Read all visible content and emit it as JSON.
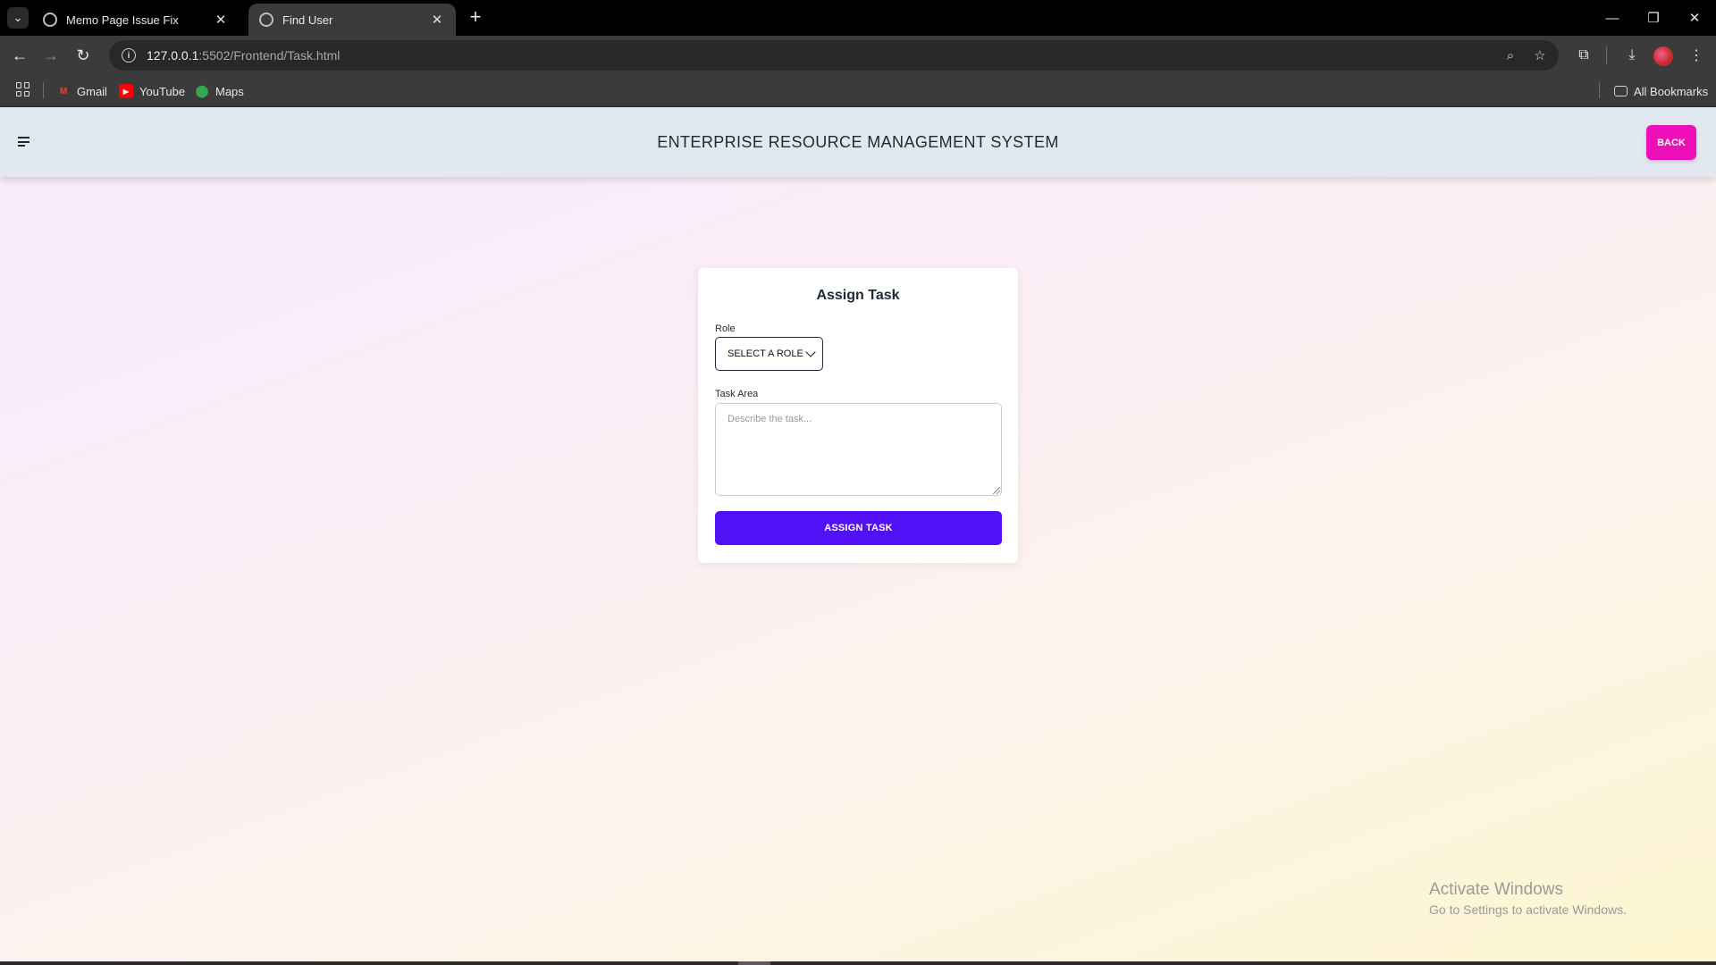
{
  "browser": {
    "tabs": [
      {
        "title": "Memo Page Issue Fix",
        "active": false
      },
      {
        "title": "Find User",
        "active": true
      }
    ],
    "url": {
      "host": "127.0.0.1",
      "path": ":5502/Frontend/Task.html"
    },
    "bookmarks": [
      {
        "label": "Gmail",
        "icon": "gmail-icon"
      },
      {
        "label": "YouTube",
        "icon": "youtube-icon"
      },
      {
        "label": "Maps",
        "icon": "maps-icon"
      }
    ],
    "all_bookmarks_label": "All Bookmarks"
  },
  "header": {
    "title": "ENTERPRISE RESOURCE MANAGEMENT SYSTEM",
    "back_label": "BACK",
    "back_color": "#ec0fb7"
  },
  "form": {
    "title": "Assign Task",
    "role_label": "Role",
    "role_selected": "SELECT A ROLE",
    "task_label": "Task Area",
    "task_placeholder": "Describe the task...",
    "task_value": "",
    "submit_label": "ASSIGN TASK",
    "submit_color": "#5110f5"
  },
  "watermark": {
    "title": "Activate Windows",
    "subtitle": "Go to Settings to activate Windows."
  }
}
